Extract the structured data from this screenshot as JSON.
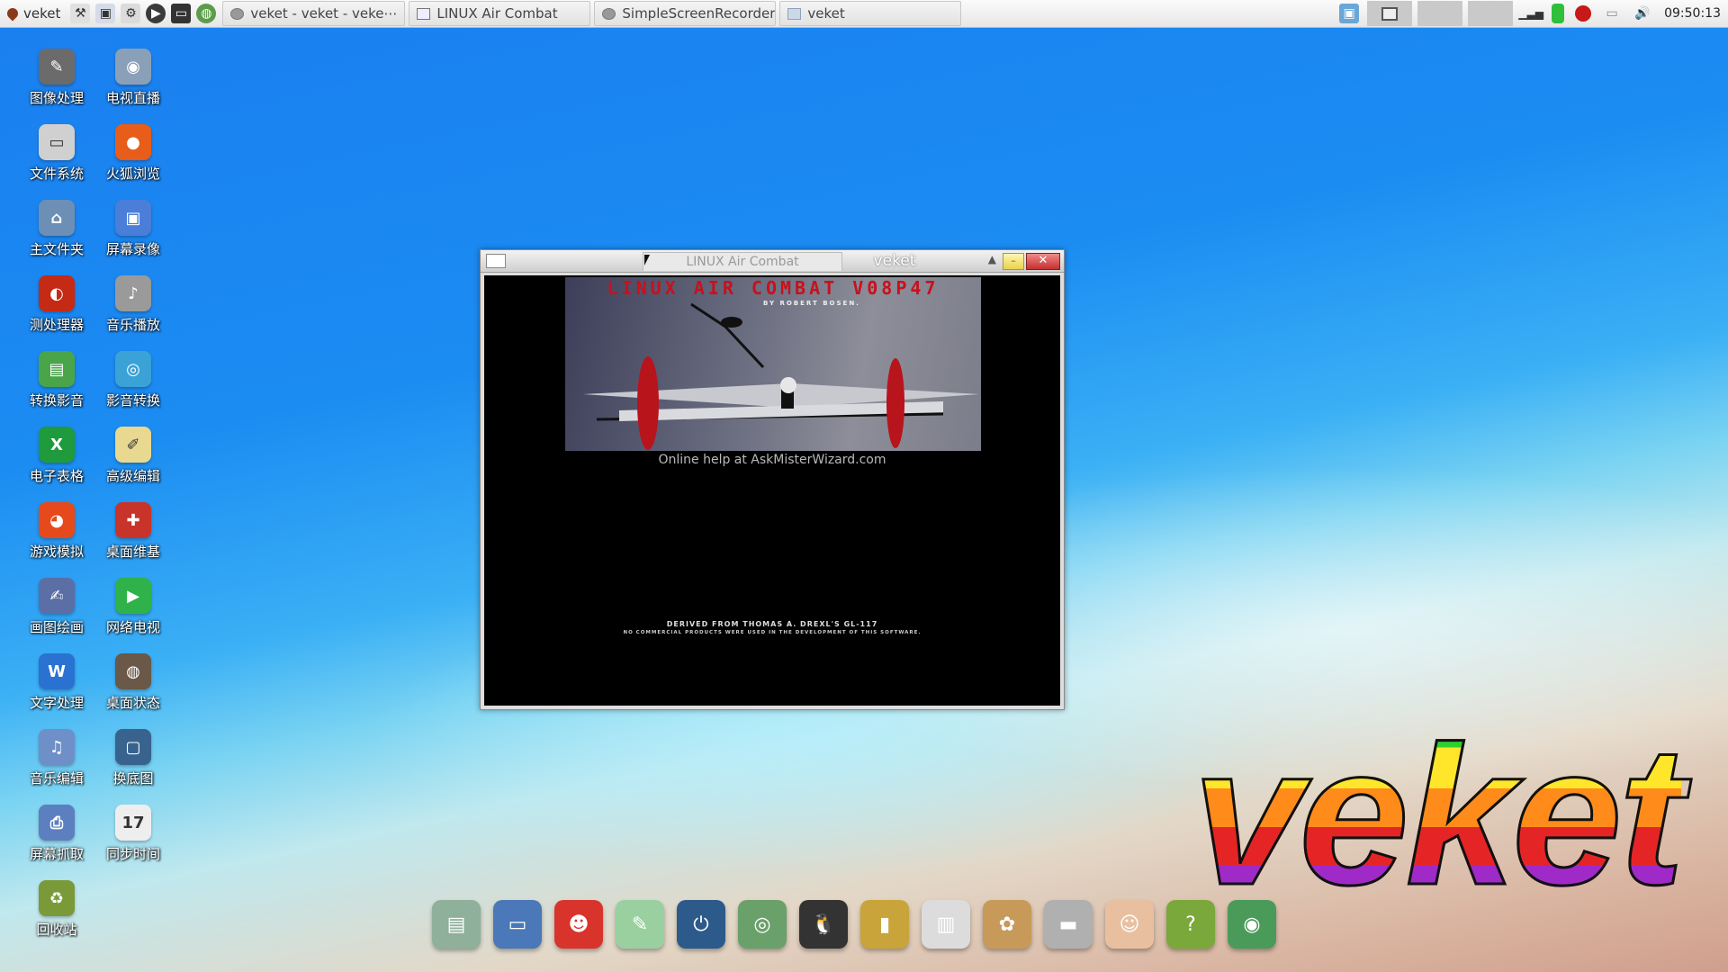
{
  "panel": {
    "menu_label": "veket",
    "tasks": [
      {
        "label": "veket - veket - veke⋯",
        "icon": "browser-icon"
      },
      {
        "label": "LINUX Air Combat",
        "icon": "window-icon"
      },
      {
        "label": "SimpleScreenRecorder",
        "icon": "recorder-icon"
      },
      {
        "label": "veket",
        "icon": "folder-icon"
      }
    ],
    "clock": "09:50:13"
  },
  "desktop_icons": [
    {
      "label": "图像处理",
      "color": "#6b6b6b",
      "glyph": "✎"
    },
    {
      "label": "电视直播",
      "color": "#8aa0b8",
      "glyph": "◉"
    },
    {
      "label": "文件系统",
      "color": "#d0d0d0",
      "glyph": "▭"
    },
    {
      "label": "火狐浏览",
      "color": "#e85d1a",
      "glyph": "●"
    },
    {
      "label": "主文件夹",
      "color": "#6e8fb5",
      "glyph": "⌂"
    },
    {
      "label": "屏幕录像",
      "color": "#4a7ed8",
      "glyph": "▣"
    },
    {
      "label": "测处理器",
      "color": "#c42a14",
      "glyph": "◐"
    },
    {
      "label": "音乐播放",
      "color": "#9a9a9a",
      "glyph": "♪"
    },
    {
      "label": "转换影音",
      "color": "#4aa54a",
      "glyph": "▤"
    },
    {
      "label": "影音转换",
      "color": "#3aa2d6",
      "glyph": "◎"
    },
    {
      "label": "电子表格",
      "color": "#1f9a3d",
      "glyph": "X"
    },
    {
      "label": "高级编辑",
      "color": "#e8d890",
      "glyph": "✐"
    },
    {
      "label": "游戏模拟",
      "color": "#e64a1c",
      "glyph": "◕"
    },
    {
      "label": "桌面维基",
      "color": "#c8342a",
      "glyph": "✚"
    },
    {
      "label": "画图绘画",
      "color": "#5b6fa6",
      "glyph": "✍"
    },
    {
      "label": "网络电视",
      "color": "#2fb24a",
      "glyph": "▶"
    },
    {
      "label": "文字处理",
      "color": "#2a72d2",
      "glyph": "W"
    },
    {
      "label": "桌面状态",
      "color": "#6a5848",
      "glyph": "◍"
    },
    {
      "label": "音乐编辑",
      "color": "#6f8fc8",
      "glyph": "♫"
    },
    {
      "label": "换底图",
      "color": "#39638f",
      "glyph": "▢"
    },
    {
      "label": "屏幕抓取",
      "color": "#5b7fbf",
      "glyph": "⎙"
    },
    {
      "label": "同步时间",
      "color": "#eeeeee",
      "glyph": "17"
    },
    {
      "label": "回收站",
      "color": "#7a9a3a",
      "glyph": "♻"
    }
  ],
  "window": {
    "tab_game": "LINUX Air Combat",
    "tab_veket": "veket",
    "game": {
      "title": "LINUX AIR COMBAT V08P47",
      "byline": "BY ROBERT BOSEN.",
      "help": "Online help at AskMisterWizard.com",
      "derived": "DERIVED FROM THOMAS A. DREXL'S GL-117",
      "no_commercial": "NO COMMERCIAL PRODUCTS WERE USED IN THE DEVELOPMENT OF THIS SOFTWARE."
    }
  },
  "dock": [
    {
      "name": "files-dock-icon",
      "color": "#8fb09a",
      "glyph": "▤"
    },
    {
      "name": "monitor-dock-icon",
      "color": "#4a78b8",
      "glyph": "▭"
    },
    {
      "name": "mascot-dock-icon",
      "color": "#d8342c",
      "glyph": "☻"
    },
    {
      "name": "editor-dock-icon",
      "color": "#9ad0a0",
      "glyph": "✎"
    },
    {
      "name": "power-dock-icon",
      "color": "#2c5a8a",
      "glyph": "⏻"
    },
    {
      "name": "network-dock-icon",
      "color": "#6aa06a",
      "glyph": "◎"
    },
    {
      "name": "penguin-dock-icon",
      "color": "#333333",
      "glyph": "🐧"
    },
    {
      "name": "book-dock-icon",
      "color": "#c8a43a",
      "glyph": "▮"
    },
    {
      "name": "chart-dock-icon",
      "color": "#dcdcdc",
      "glyph": "▥"
    },
    {
      "name": "palette-dock-icon",
      "color": "#c89a5a",
      "glyph": "✿"
    },
    {
      "name": "usb-dock-icon",
      "color": "#b0b0b0",
      "glyph": "▬"
    },
    {
      "name": "veket-dock-icon",
      "color": "#e8c0a0",
      "glyph": "☺"
    },
    {
      "name": "help-dock-icon",
      "color": "#7aa83a",
      "glyph": "?"
    },
    {
      "name": "camera-dock-icon",
      "color": "#4a9a5a",
      "glyph": "◉"
    }
  ],
  "wallpaper_logo": "veket"
}
